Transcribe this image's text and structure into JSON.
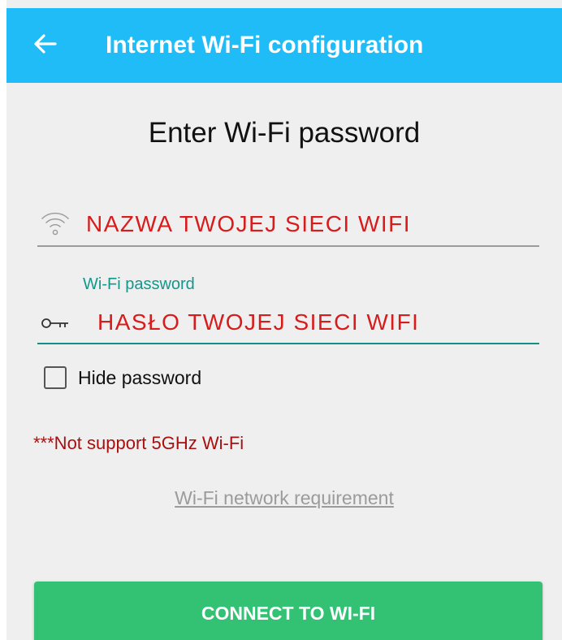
{
  "app_bar": {
    "title": "Internet Wi-Fi configuration",
    "back_icon": "arrow-left-icon",
    "color": "#1fbcf7"
  },
  "heading": "Enter Wi-Fi password",
  "ssid_field": {
    "icon": "wifi-icon",
    "value": "NAZWA TWOJEJ SIECI WIFI"
  },
  "password_field": {
    "label": "Wi-Fi password",
    "icon": "key-icon",
    "value": "HASŁO TWOJEJ SIECI WIFI"
  },
  "hide_password": {
    "label": "Hide password",
    "checked": false
  },
  "warning": "***Not support 5GHz Wi-Fi",
  "requirement_link": "Wi-Fi network requirement",
  "connect_button": {
    "label": "CONNECT TO WI-FI",
    "color": "#33c274"
  },
  "colors": {
    "accent_teal": "#138f86",
    "error_red": "#a80f0f",
    "overlay_text_red": "#d81b1b"
  }
}
